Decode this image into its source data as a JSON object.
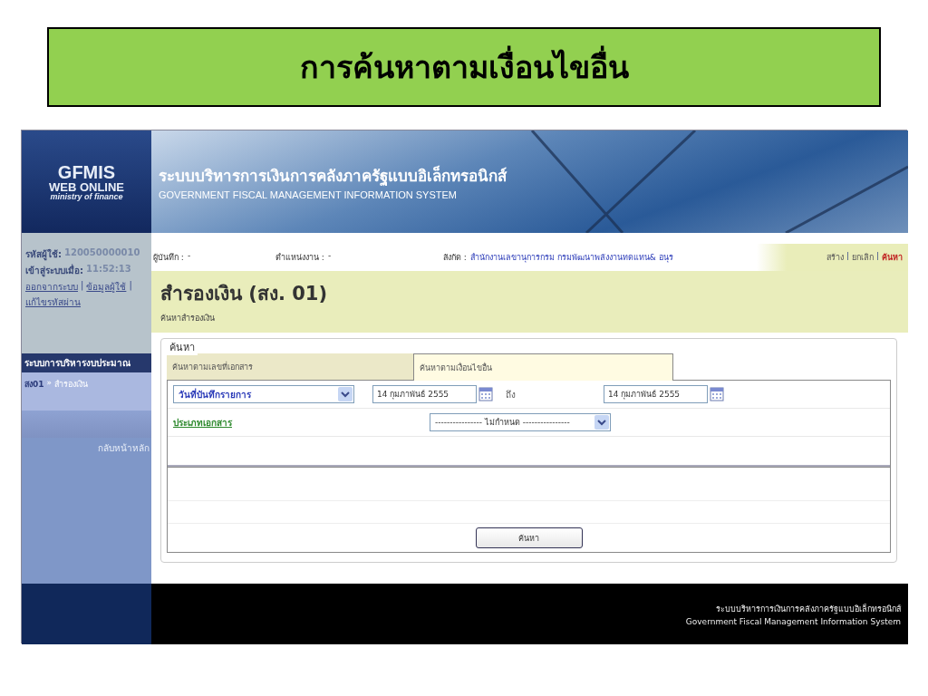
{
  "slide_title": "การค้นหาตามเงื่อนไขอื่น",
  "header": {
    "logo_lines": [
      "GFMIS",
      "WEB ONLINE",
      "ministry of finance"
    ],
    "system_title_th": "ระบบบริหารการเงินการคลังภาครัฐแบบอิเล็กทรอนิกส์",
    "system_title_en": "GOVERNMENT FISCAL MANAGEMENT INFORMATION SYSTEM"
  },
  "sidebar": {
    "user_id_label": "รหัสผู้ใช้:",
    "user_id": "120050000010",
    "login_label": "เข้าสู่ระบบเมื่อ:",
    "login_time": "11:52:13",
    "links": [
      "ออกจากระบบ",
      "ข้อมูลผู้ใช้",
      "แก้ไขรหัสผ่าน"
    ],
    "separator": "|",
    "section": "ระบบการบริหารงบประมาณ",
    "breadcrumb": {
      "code": "สง01",
      "arrow": "»",
      "page": "สำรองเงิน"
    },
    "back_link": "กลับหน้าหลัก"
  },
  "info_bar": [
    {
      "label": "ผู้บันทึก :",
      "value": "-"
    },
    {
      "label": "ตำแหน่งงาน :",
      "value": "-"
    },
    {
      "label": "สังกัด :",
      "value": "สำนักงานเลขานุการกรม กรมพัฒนาพลังงานทดแทน& อนุร"
    }
  ],
  "actions": [
    {
      "label": "สร้าง",
      "selected": false
    },
    {
      "label": "ยกเลิก",
      "selected": false
    },
    {
      "label": "ค้นหา",
      "selected": true
    }
  ],
  "page_title": "สำรองเงิน (สง. 01)",
  "page_subtitle": "ค้นหาสำรองเงิน",
  "search": {
    "legend": "ค้นหา",
    "tabs": [
      {
        "label": "ค้นหาตามเลขที่เอกสาร",
        "selected": false
      },
      {
        "label": "ค้นหาตามเงื่อนไขอื่น",
        "selected": true
      }
    ],
    "date_type": "วันที่บันทึกรายการ",
    "date_from": "14 กุมภาพันธ์ 2555",
    "to_label": "ถึง",
    "date_to": "14 กุมภาพันธ์ 2555",
    "doc_type_label": "ประเภทเอกสาร",
    "doc_type": "---------------- ไม่กำหนด ----------------",
    "button": "ค้นหา"
  },
  "footer": {
    "line_th": "ระบบบริหารการเงินการคลังภาครัฐแบบอิเล็กทรอนิกส์",
    "line_en": "Government Fiscal Management Information System"
  }
}
